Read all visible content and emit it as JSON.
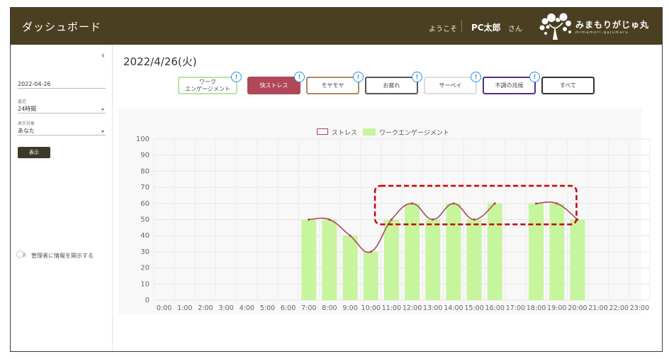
{
  "header": {
    "title": "ダッシュボード",
    "welcome": "ようこそ",
    "user_name": "PC太郎",
    "honorific": "さん",
    "brand": "みまもりがじゅ丸",
    "brand_sub": "mimamori-gajumaru"
  },
  "sidebar": {
    "collapse_icon": "‹",
    "date_value": "2022-04-26",
    "period_label": "直近",
    "period_value": "24時間",
    "target_label": "表示対象",
    "target_value": "あなた",
    "show_button": "表示",
    "toggle_label": "管理者に情報を開示する"
  },
  "main": {
    "date_title": "2022/4/26(火)",
    "categories": [
      {
        "label": "ワーク\nエンゲージメント",
        "border": "#b8e59a",
        "fill": "#ffffff",
        "text": "#444444",
        "badge": "!"
      },
      {
        "label": "快ストレス",
        "border": "#b04858",
        "fill": "#b04858",
        "text": "#ffffff",
        "badge": "!"
      },
      {
        "label": "モヤモヤ",
        "border": "#b08860",
        "fill": "#ffffff",
        "text": "#444444",
        "badge": "!"
      },
      {
        "label": "お疲れ",
        "border": "#555555",
        "fill": "#ffffff",
        "text": "#444444",
        "badge": "!"
      },
      {
        "label": "サーベイ",
        "border": "#dddddd",
        "fill": "#ffffff",
        "text": "#444444",
        "badge": "!"
      },
      {
        "label": "不調の兆候",
        "border": "#5a2a8a",
        "fill": "#ffffff",
        "text": "#444444",
        "badge": "!"
      },
      {
        "label": "すべて",
        "border": "#333333",
        "fill": "#ffffff",
        "text": "#444444",
        "badge": ""
      }
    ]
  },
  "chart_data": {
    "type": "bar",
    "categories": [
      "0:00",
      "1:00",
      "2:00",
      "3:00",
      "4:00",
      "5:00",
      "6:00",
      "7:00",
      "8:00",
      "9:00",
      "10:00",
      "11:00",
      "12:00",
      "13:00",
      "14:00",
      "15:00",
      "16:00",
      "17:00",
      "18:00",
      "19:00",
      "20:00",
      "21:00",
      "22:00",
      "23:00"
    ],
    "series": [
      {
        "name": "ワークエンゲージメント",
        "type": "bar",
        "color": "#c6f59e",
        "values": [
          null,
          null,
          null,
          null,
          null,
          null,
          null,
          50,
          50,
          40,
          30,
          50,
          60,
          50,
          60,
          50,
          60,
          null,
          60,
          60,
          50,
          null,
          null,
          null
        ]
      },
      {
        "name": "ストレス",
        "type": "line",
        "color": "#b04858",
        "values": [
          null,
          null,
          null,
          null,
          null,
          null,
          null,
          50,
          50,
          40,
          30,
          50,
          60,
          50,
          60,
          50,
          60,
          null,
          60,
          60,
          50,
          null,
          null,
          null
        ]
      }
    ],
    "ylim": [
      0,
      100
    ],
    "yticks": [
      0,
      10,
      20,
      30,
      40,
      50,
      60,
      70,
      80,
      90,
      100
    ],
    "grid": true,
    "legend": "top-center",
    "highlight": {
      "x_from": "11:00",
      "x_to": "19:00",
      "y_from": 47,
      "y_to": 71,
      "color": "#cc0000",
      "style": "dashed"
    }
  }
}
